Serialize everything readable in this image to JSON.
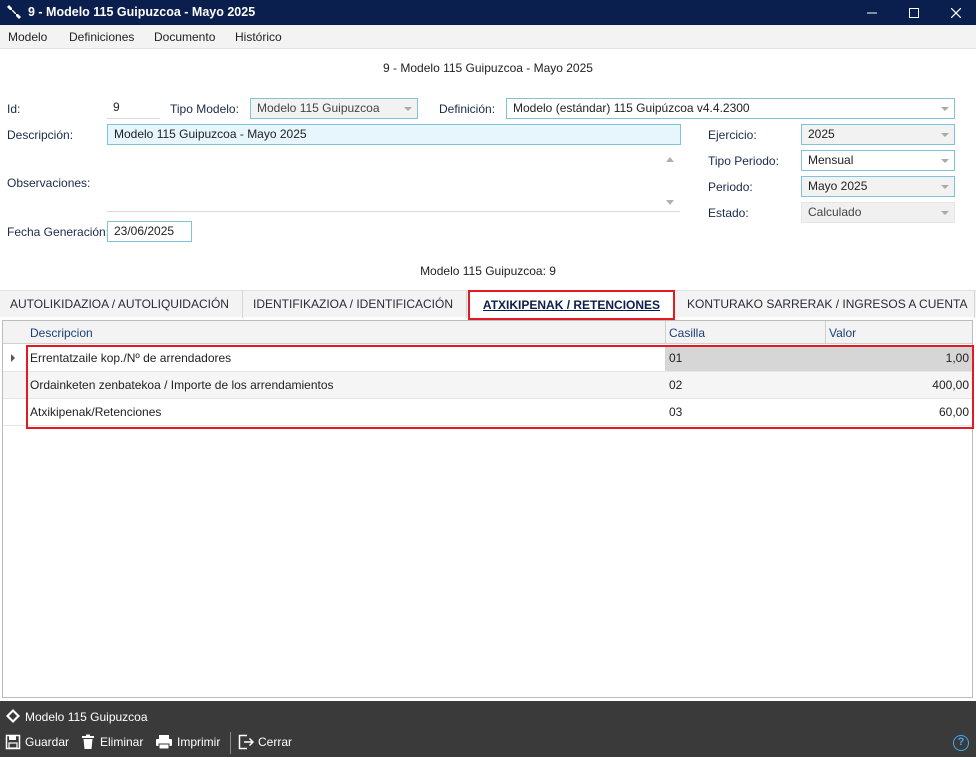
{
  "window": {
    "title": "9 - Modelo 115 Guipuzcoa - Mayo 2025"
  },
  "menu": {
    "items": [
      "Modelo",
      "Definiciones",
      "Documento",
      "Histórico"
    ]
  },
  "form": {
    "title": "9 - Modelo 115 Guipuzcoa - Mayo 2025",
    "id_label": "Id:",
    "id_value": "9",
    "tipo_modelo_label": "Tipo Modelo:",
    "tipo_modelo_value": "Modelo 115 Guipuzcoa",
    "definicion_label": "Definición:",
    "definicion_value": "Modelo (estándar) 115 Guipúzcoa v4.4.2300",
    "descripcion_label": "Descripción:",
    "descripcion_value": "Modelo 115 Guipuzcoa - Mayo 2025",
    "observaciones_label": "Observaciones:",
    "fecha_label": "Fecha Generación:",
    "fecha_value": "23/06/2025",
    "ejercicio_label": "Ejercicio:",
    "ejercicio_value": "2025",
    "tipo_periodo_label": "Tipo Periodo:",
    "tipo_periodo_value": "Mensual",
    "periodo_label": "Periodo:",
    "periodo_value": "Mayo 2025",
    "estado_label": "Estado:",
    "estado_value": "Calculado"
  },
  "subtitle": "Modelo 115 Guipuzcoa: 9",
  "tabs": [
    {
      "label": "AUTOLIKIDAZIOA / AUTOLIQUIDACIÓN"
    },
    {
      "label": "IDENTIFIKAZIOA / IDENTIFICACIÓN"
    },
    {
      "label": "ATXIKIPENAK / RETENCIONES"
    },
    {
      "label": "KONTURAKO SARRERAK / INGRESOS A CUENTA"
    }
  ],
  "grid": {
    "columns": [
      "Descripcion",
      "Casilla",
      "Valor"
    ],
    "rows": [
      {
        "descripcion": "Errentatzaile kop./Nº de arrendadores",
        "casilla": "01",
        "valor": "1,00"
      },
      {
        "descripcion": "Ordainketen zenbatekoa / Importe de los arrendamientos",
        "casilla": "02",
        "valor": "400,00"
      },
      {
        "descripcion": "Atxikipenak/Retenciones",
        "casilla": "03",
        "valor": "60,00"
      }
    ]
  },
  "footer": {
    "doc_label": "Modelo 115 Guipuzcoa",
    "guardar": "Guardar",
    "eliminar": "Eliminar",
    "imprimir": "Imprimir",
    "cerrar": "Cerrar",
    "help": "?"
  },
  "colors": {
    "titlebar": "#0a1f4e",
    "highlight": "#e01b24",
    "footer": "#3a3a3a"
  }
}
